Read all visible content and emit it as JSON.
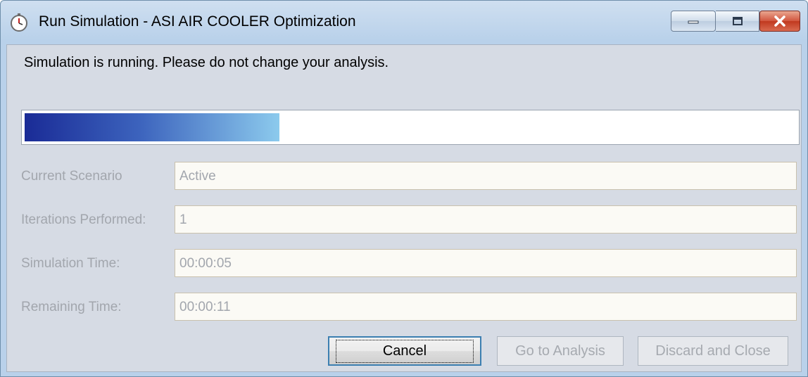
{
  "window": {
    "title": "Run Simulation - ASI AIR COOLER Optimization",
    "controls": [
      "minimize",
      "maximize",
      "close"
    ]
  },
  "status_message": "Simulation is running. Please do not change your analysis.",
  "progress": {
    "fraction": 0.33
  },
  "fields": [
    {
      "label": "Current Scenario",
      "value": "Active"
    },
    {
      "label": "Iterations Performed:",
      "value": "1"
    },
    {
      "label": "Simulation Time:",
      "value": "00:00:05"
    },
    {
      "label": "Remaining Time:",
      "value": "00:00:11"
    }
  ],
  "buttons": {
    "cancel": "Cancel",
    "go_to_analysis": "Go to Analysis",
    "discard_and_close": "Discard and Close"
  },
  "colors": {
    "progress_start": "#1a2b96",
    "progress_end": "#8ccaed",
    "close_button": "#c0391f",
    "disabled_text": "#a2a6ad"
  }
}
